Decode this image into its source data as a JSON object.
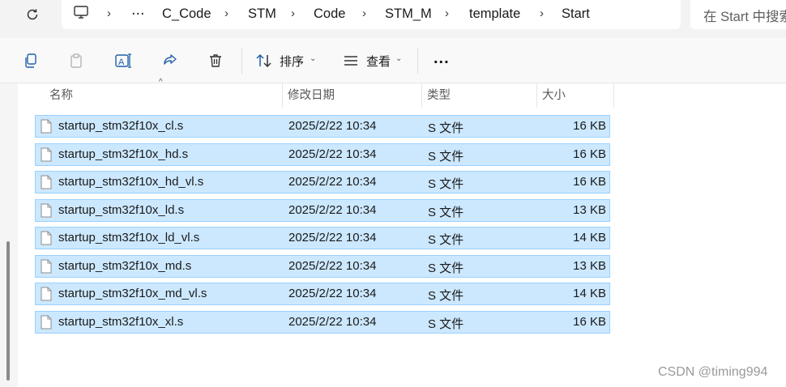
{
  "address_bar": {
    "refresh_icon": "refresh-icon",
    "computer_icon": "computer-icon",
    "ellipsis": "⋯",
    "breadcrumbs": [
      "C_Code",
      "STM",
      "Code",
      "STM_M",
      "template",
      "Start"
    ],
    "separator": "›"
  },
  "search": {
    "placeholder": "在 Start 中搜索"
  },
  "toolbar": {
    "icons": [
      "copy-icon",
      "paste-icon",
      "rename-icon",
      "share-icon",
      "delete-icon"
    ],
    "sort_label": "排序",
    "view_label": "查看",
    "more_label": "..."
  },
  "columns": {
    "name": "名称",
    "date": "修改日期",
    "type": "类型",
    "size": "大小",
    "sort_indicator": "^"
  },
  "files": [
    {
      "name": "startup_stm32f10x_cl.s",
      "date": "2025/2/22 10:34",
      "type": "S 文件",
      "size": "16 KB"
    },
    {
      "name": "startup_stm32f10x_hd.s",
      "date": "2025/2/22 10:34",
      "type": "S 文件",
      "size": "16 KB"
    },
    {
      "name": "startup_stm32f10x_hd_vl.s",
      "date": "2025/2/22 10:34",
      "type": "S 文件",
      "size": "16 KB"
    },
    {
      "name": "startup_stm32f10x_ld.s",
      "date": "2025/2/22 10:34",
      "type": "S 文件",
      "size": "13 KB"
    },
    {
      "name": "startup_stm32f10x_ld_vl.s",
      "date": "2025/2/22 10:34",
      "type": "S 文件",
      "size": "14 KB"
    },
    {
      "name": "startup_stm32f10x_md.s",
      "date": "2025/2/22 10:34",
      "type": "S 文件",
      "size": "13 KB"
    },
    {
      "name": "startup_stm32f10x_md_vl.s",
      "date": "2025/2/22 10:34",
      "type": "S 文件",
      "size": "14 KB"
    },
    {
      "name": "startup_stm32f10x_xl.s",
      "date": "2025/2/22 10:34",
      "type": "S 文件",
      "size": "16 KB"
    }
  ],
  "watermark": "CSDN @timing994",
  "colors": {
    "selection_bg": "#cce8ff",
    "selection_border": "#99d1ff",
    "toolbar_bg": "#f9f9f9"
  }
}
